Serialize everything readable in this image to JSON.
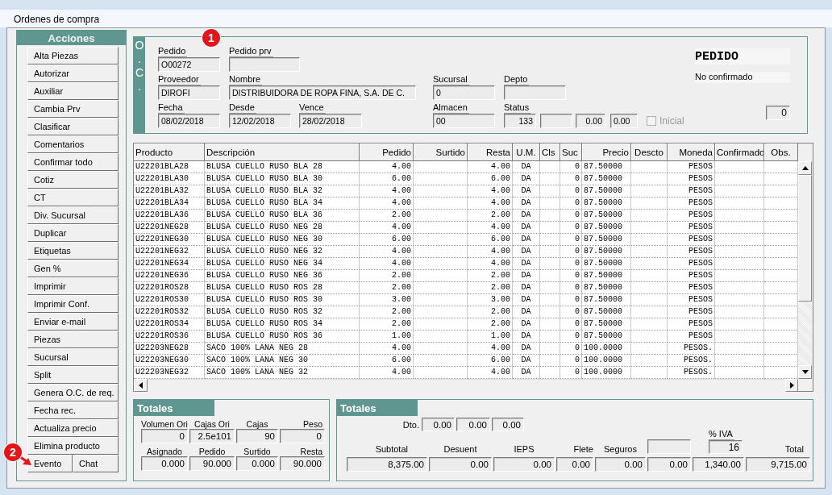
{
  "window": {
    "title": "Ordenes de compra"
  },
  "actions": {
    "title": "Acciones",
    "buttons": [
      "Alta Piezas",
      "Autorizar",
      "Auxiliar",
      "Cambia Prv",
      "Clasificar",
      "Comentarios",
      "Confirmar todo",
      "Cotiz",
      "CT",
      "Div. Sucursal",
      "Duplicar",
      "Etiquetas",
      "Gen %",
      "Imprimir",
      "Imprimir Conf.",
      "Enviar e-mail",
      "Piezas",
      "Sucursal",
      "Split",
      "Genera O.C. de req.",
      "Fecha rec.",
      "Actualiza precio",
      "Elimina producto"
    ],
    "bottom_buttons": [
      "Evento",
      "Chat"
    ]
  },
  "order": {
    "side_label": "O . C .",
    "fields": [
      {
        "kind": "text",
        "label": "Pedido",
        "value": "O00272"
      },
      {
        "kind": "text",
        "label": "Pedido prv"
      },
      {
        "kind": "text",
        "label": "Proveedor",
        "value": "DIROFI"
      },
      {
        "kind": "text",
        "label": "Nombre",
        "value": "DISTRIBUIDORA DE ROPA FINA, S.A. DE C."
      },
      {
        "kind": "text",
        "label": "Sucursal",
        "value": "0"
      },
      {
        "kind": "text",
        "label": "Depto"
      },
      {
        "kind": "text",
        "label": "Fecha",
        "value": "08/02/2018"
      },
      {
        "kind": "text",
        "label": "Desde",
        "value": "12/02/2018"
      },
      {
        "kind": "text",
        "label": "Vence",
        "value": "28/02/2018"
      },
      {
        "kind": "text",
        "label": "Almacen",
        "value": "00"
      },
      {
        "kind": "number",
        "label": "Status",
        "value": "133"
      },
      {
        "kind": "number"
      },
      {
        "kind": "number",
        "value": "0.00"
      },
      {
        "kind": "text",
        "value": "0.00"
      },
      {
        "kind": "checkbox",
        "label": "Inicial",
        "checked": false,
        "disabled": true
      }
    ],
    "doc_type": "PEDIDO",
    "confirmation": "No confirmado",
    "counter": "0"
  },
  "table": {
    "columns": [
      "Producto",
      "Descripción",
      "Pedido",
      "Surtido",
      "Resta",
      "U.M.",
      "Cls",
      "Suc",
      "Precio",
      "Descto",
      "Moneda",
      "Confirmado",
      "Obs."
    ],
    "rows": [
      {
        "producto": "U22201BLA28",
        "descripcion": "BLUSA CUELLO RUSO BLA 28",
        "pedido": "4.00",
        "resta": "4.00",
        "um": "DA",
        "suc": "0",
        "precio": "87.50000",
        "moneda": "PESOS"
      },
      {
        "producto": "U22201BLA30",
        "descripcion": "BLUSA CUELLO RUSO BLA 30",
        "pedido": "6.00",
        "resta": "6.00",
        "um": "DA",
        "suc": "0",
        "precio": "87.50000",
        "moneda": "PESOS"
      },
      {
        "producto": "U22201BLA32",
        "descripcion": "BLUSA CUELLO RUSO BLA 32",
        "pedido": "4.00",
        "resta": "4.00",
        "um": "DA",
        "suc": "0",
        "precio": "87.50000",
        "moneda": "PESOS"
      },
      {
        "producto": "U22201BLA34",
        "descripcion": "BLUSA CUELLO RUSO BLA 34",
        "pedido": "4.00",
        "resta": "4.00",
        "um": "DA",
        "suc": "0",
        "precio": "87.50000",
        "moneda": "PESOS"
      },
      {
        "producto": "U22201BLA36",
        "descripcion": "BLUSA CUELLO RUSO BLA 36",
        "pedido": "2.00",
        "resta": "2.00",
        "um": "DA",
        "suc": "0",
        "precio": "87.50000",
        "moneda": "PESOS"
      },
      {
        "producto": "U22201NEG28",
        "descripcion": "BLUSA CUELLO RUSO NEG 28",
        "pedido": "4.00",
        "resta": "4.00",
        "um": "DA",
        "suc": "0",
        "precio": "87.50000",
        "moneda": "PESOS"
      },
      {
        "producto": "U22201NEG30",
        "descripcion": "BLUSA CUELLO RUSO NEG 30",
        "pedido": "6.00",
        "resta": "6.00",
        "um": "DA",
        "suc": "0",
        "precio": "87.50000",
        "moneda": "PESOS"
      },
      {
        "producto": "U22201NEG32",
        "descripcion": "BLUSA CUELLO RUSO NEG 32",
        "pedido": "4.00",
        "resta": "4.00",
        "um": "DA",
        "suc": "0",
        "precio": "87.50000",
        "moneda": "PESOS"
      },
      {
        "producto": "U22201NEG34",
        "descripcion": "BLUSA CUELLO RUSO NEG 34",
        "pedido": "4.00",
        "resta": "4.00",
        "um": "DA",
        "suc": "0",
        "precio": "87.50000",
        "moneda": "PESOS"
      },
      {
        "producto": "U22201NEG36",
        "descripcion": "BLUSA CUELLO RUSO NEG 36",
        "pedido": "2.00",
        "resta": "2.00",
        "um": "DA",
        "suc": "0",
        "precio": "87.50000",
        "moneda": "PESOS"
      },
      {
        "producto": "U22201ROS28",
        "descripcion": "BLUSA CUELLO RUSO ROS 28",
        "pedido": "2.00",
        "resta": "2.00",
        "um": "DA",
        "suc": "0",
        "precio": "87.50000",
        "moneda": "PESOS"
      },
      {
        "producto": "U22201ROS30",
        "descripcion": "BLUSA CUELLO RUSO ROS 30",
        "pedido": "3.00",
        "resta": "3.00",
        "um": "DA",
        "suc": "0",
        "precio": "87.50000",
        "moneda": "PESOS"
      },
      {
        "producto": "U22201ROS32",
        "descripcion": "BLUSA CUELLO RUSO ROS 32",
        "pedido": "2.00",
        "resta": "2.00",
        "um": "DA",
        "suc": "0",
        "precio": "87.50000",
        "moneda": "PESOS"
      },
      {
        "producto": "U22201ROS34",
        "descripcion": "BLUSA CUELLO RUSO ROS 34",
        "pedido": "2.00",
        "resta": "2.00",
        "um": "DA",
        "suc": "0",
        "precio": "87.50000",
        "moneda": "PESOS"
      },
      {
        "producto": "U22201ROS36",
        "descripcion": "BLUSA CUELLO RUSO ROS 36",
        "pedido": "1.00",
        "resta": "1.00",
        "um": "DA",
        "suc": "0",
        "precio": "87.50000",
        "moneda": "PESOS"
      },
      {
        "producto": "U22203NEG28",
        "descripcion": "SACO 100% LANA NEG 28",
        "pedido": "4.00",
        "resta": "4.00",
        "um": "DA",
        "suc": "0",
        "precio": "100.0000",
        "moneda": "PESOS."
      },
      {
        "producto": "U22203NEG30",
        "descripcion": "SACO 100% LANA NEG 30",
        "pedido": "6.00",
        "resta": "6.00",
        "um": "DA",
        "suc": "0",
        "precio": "100.0000",
        "moneda": "PESOS."
      },
      {
        "producto": "U22203NEG32",
        "descripcion": "SACO 100% LANA NEG 32",
        "pedido": "4.00",
        "resta": "4.00",
        "um": "DA",
        "suc": "0",
        "precio": "100.0000",
        "moneda": "PESOS."
      }
    ]
  },
  "totals_left": {
    "title": "Totales",
    "groups": [
      [
        {
          "label": "Volumen Ori",
          "value": "0"
        },
        {
          "label": "Cajas Ori",
          "value": "2.5e101"
        },
        {
          "label": "Cajas",
          "value": "90"
        },
        {
          "label": "Peso",
          "value": "0"
        }
      ],
      [
        {
          "label": "Asignado",
          "value": "0.000"
        },
        {
          "label": "Pedido",
          "value": "90.000"
        },
        {
          "label": "Surtido",
          "value": "0.000"
        },
        {
          "label": "Resta",
          "value": "90.000"
        }
      ]
    ]
  },
  "totals_right": {
    "title": "Totales",
    "discount": {
      "label": "Dto.",
      "values": [
        "0.00",
        "0.00",
        "0.00"
      ]
    },
    "columns": [
      {
        "kind": "label",
        "label": "Subtotal",
        "value": "8,375.00"
      },
      {
        "kind": "label",
        "label": "Desuent",
        "value": "0.00"
      },
      {
        "kind": "label",
        "label": "IEPS",
        "value": "0.00"
      },
      {
        "kind": "label",
        "label": "Flete",
        "value": "0.00"
      },
      {
        "kind": "label",
        "label": "Seguros",
        "value": "0.00"
      },
      {
        "kind": "field",
        "value": "0.00"
      },
      {
        "kind": "rate",
        "label": "% IVA",
        "rate": "16",
        "value": "1,340.00"
      },
      {
        "kind": "label",
        "label": "Total",
        "value": "9,715.00"
      }
    ]
  },
  "annotations": [
    {
      "label": "1"
    },
    {
      "label": "2",
      "arrow": true
    }
  ]
}
